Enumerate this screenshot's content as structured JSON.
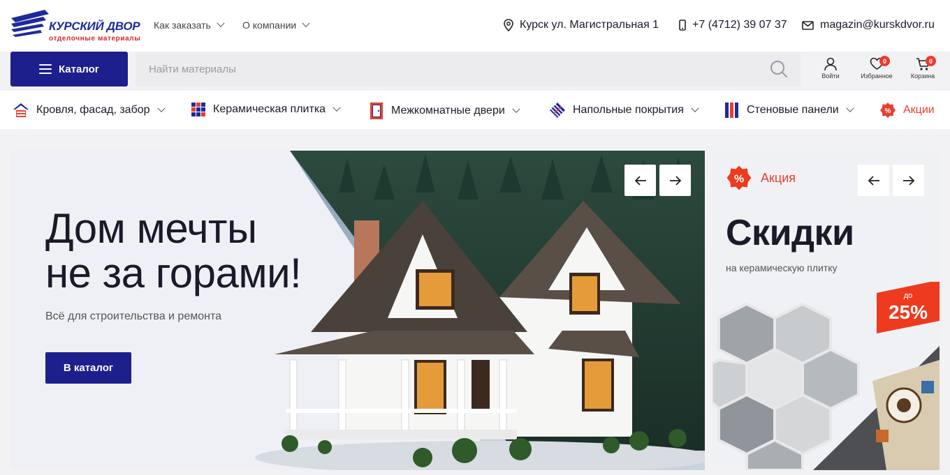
{
  "header": {
    "logo_title": "КУРСКИЙ ДВОР",
    "logo_subtitle": "отделочные материалы",
    "nav": [
      {
        "label": "Как заказать"
      },
      {
        "label": "О компании"
      }
    ],
    "address": "Курск ул. Магистральная 1",
    "phone": "+7 (4712) 39 07 37",
    "email": "magazin@kurskdvor.ru"
  },
  "toolbar": {
    "catalog_label": "Каталог",
    "search_placeholder": "Найти материалы",
    "login_label": "Войти",
    "favorites_label": "Избранное",
    "favorites_count": "0",
    "cart_label": "Корзина",
    "cart_count": "0"
  },
  "categories": [
    {
      "label": "Кровля, фасад, забор",
      "icon": "house-roof-icon"
    },
    {
      "label": "Керамическая плитка",
      "icon": "tile-grid-icon"
    },
    {
      "label": "Межкомнатные двери",
      "icon": "door-icon"
    },
    {
      "label": "Напольные покрытия",
      "icon": "floor-diamond-icon"
    },
    {
      "label": "Стеновые панели",
      "icon": "wall-panels-icon"
    },
    {
      "label": "Акции",
      "icon": "percent-badge-icon"
    }
  ],
  "hero": {
    "title_line1": "Дом мечты",
    "title_line2": "не за горами!",
    "subtitle": "Всё для строительства и ремонта",
    "button_label": "В каталог"
  },
  "promo": {
    "tag": "Акция",
    "title": "Скидки",
    "subtitle": "на керамическую плитку",
    "discount_prefix": "до",
    "discount_value": "25%"
  },
  "colors": {
    "brand_blue": "#1d1f8c",
    "accent_red": "#e8402d",
    "badge_red": "#ee3a2e"
  }
}
